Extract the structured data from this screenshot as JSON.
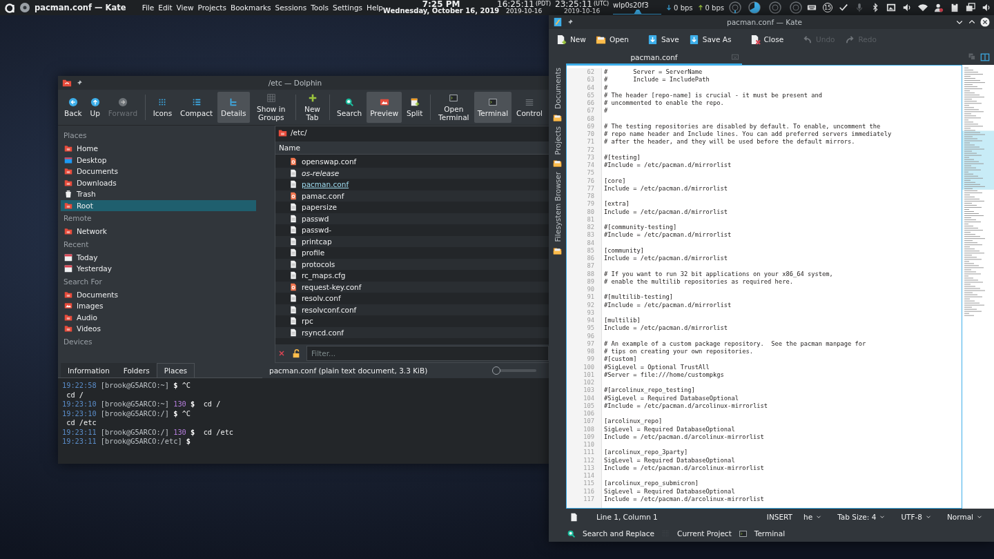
{
  "top_panel": {
    "app_title": "pacman.conf — Kate",
    "menu": [
      "File",
      "Edit",
      "View",
      "Projects",
      "Bookmarks",
      "Sessions",
      "Tools",
      "Settings",
      "Help"
    ],
    "clock": {
      "time": "7:25 PM",
      "date": "Wednesday, October 16, 2019"
    },
    "world_clocks": [
      {
        "time": "16:25:11",
        "zone": "(PDT)",
        "date": "2019-10-16"
      },
      {
        "time": "23:25:11",
        "zone": "(UTC)",
        "date": "2019-10-16"
      }
    ],
    "network": {
      "interface": "wlp0s20f3",
      "down": "0 bps",
      "up": "0 bps"
    },
    "notifications": "15"
  },
  "dolphin": {
    "title": "/etc — Dolphin",
    "toolbar": [
      [
        {
          "label": "Back",
          "selected": false,
          "disabled": false
        },
        {
          "label": "Up",
          "selected": false,
          "disabled": false
        },
        {
          "label": "Forward",
          "selected": false,
          "disabled": true
        }
      ],
      [
        {
          "label": "Icons",
          "selected": false,
          "disabled": false
        },
        {
          "label": "Compact",
          "selected": false,
          "disabled": false
        },
        {
          "label": "Details",
          "selected": true,
          "disabled": false
        },
        {
          "label": "Show in Groups",
          "selected": false,
          "disabled": false
        }
      ],
      [
        {
          "label": "New Tab",
          "selected": false,
          "disabled": false
        }
      ],
      [
        {
          "label": "Search",
          "selected": false,
          "disabled": false
        },
        {
          "label": "Preview",
          "selected": true,
          "disabled": false
        },
        {
          "label": "Split",
          "selected": false,
          "disabled": false
        }
      ],
      [
        {
          "label": "Open Terminal",
          "selected": false,
          "disabled": false
        },
        {
          "label": "Terminal",
          "selected": true,
          "disabled": false
        },
        {
          "label": "Control",
          "selected": false,
          "disabled": false
        }
      ]
    ],
    "sidebar": [
      {
        "heading": "Places",
        "items": [
          {
            "label": "Home",
            "selected": false
          },
          {
            "label": "Desktop",
            "selected": false
          },
          {
            "label": "Documents",
            "selected": false
          },
          {
            "label": "Downloads",
            "selected": false
          },
          {
            "label": "Trash",
            "selected": false
          },
          {
            "label": "Root",
            "selected": true
          }
        ]
      },
      {
        "heading": "Remote",
        "items": [
          {
            "label": "Network",
            "selected": false
          }
        ]
      },
      {
        "heading": "Recent",
        "items": [
          {
            "label": "Today",
            "selected": false
          },
          {
            "label": "Yesterday",
            "selected": false
          }
        ]
      },
      {
        "heading": "Search For",
        "items": [
          {
            "label": "Documents",
            "selected": false
          },
          {
            "label": "Images",
            "selected": false
          },
          {
            "label": "Audio",
            "selected": false
          },
          {
            "label": "Videos",
            "selected": false
          }
        ]
      },
      {
        "heading": "Devices"
      }
    ],
    "path": "/etc/",
    "column": "Name",
    "files": [
      {
        "name": "openswap.conf",
        "kind": "config",
        "symlink": false,
        "hovered": false
      },
      {
        "name": "os-release",
        "kind": "text",
        "symlink": true,
        "hovered": false
      },
      {
        "name": "pacman.conf",
        "kind": "text",
        "symlink": false,
        "hovered": true
      },
      {
        "name": "pamac.conf",
        "kind": "config",
        "symlink": false,
        "hovered": false
      },
      {
        "name": "papersize",
        "kind": "text",
        "symlink": false,
        "hovered": false
      },
      {
        "name": "passwd",
        "kind": "text",
        "symlink": false,
        "hovered": false
      },
      {
        "name": "passwd-",
        "kind": "text",
        "symlink": false,
        "hovered": false
      },
      {
        "name": "printcap",
        "kind": "text",
        "symlink": false,
        "hovered": false
      },
      {
        "name": "profile",
        "kind": "text",
        "symlink": false,
        "hovered": false
      },
      {
        "name": "protocols",
        "kind": "text",
        "symlink": false,
        "hovered": false
      },
      {
        "name": "rc_maps.cfg",
        "kind": "text",
        "symlink": false,
        "hovered": false
      },
      {
        "name": "request-key.conf",
        "kind": "config",
        "symlink": false,
        "hovered": false
      },
      {
        "name": "resolv.conf",
        "kind": "text",
        "symlink": false,
        "hovered": false
      },
      {
        "name": "resolvconf.conf",
        "kind": "text",
        "symlink": false,
        "hovered": false
      },
      {
        "name": "rpc",
        "kind": "text",
        "symlink": false,
        "hovered": false
      },
      {
        "name": "rsyncd.conf",
        "kind": "text",
        "symlink": false,
        "hovered": false
      }
    ],
    "filter": {
      "placeholder": "Filter..."
    },
    "panel_tabs": [
      {
        "label": "Information",
        "selected": false
      },
      {
        "label": "Folders",
        "selected": false
      },
      {
        "label": "Places",
        "selected": true
      }
    ],
    "status": "pacman.conf (plain text document, 3.3 KiB)",
    "zoom": {
      "level": 0
    },
    "terminal": [
      {
        "kind": "prompt",
        "time": "19:22:58",
        "prompt": "[brook@G5ARCO:~]",
        "symbol": "$",
        "command": "^C"
      },
      {
        "kind": "output",
        "text": "cd /"
      },
      {
        "kind": "prompt",
        "time": "19:23:10",
        "prompt": "[brook@G5ARCO:~]",
        "code": "130",
        "symbol": "$",
        "command": " cd /"
      },
      {
        "kind": "prompt",
        "time": "19:23:10",
        "prompt": "[brook@G5ARCO:/]",
        "symbol": "$",
        "command": "^C"
      },
      {
        "kind": "output",
        "text": "cd /etc"
      },
      {
        "kind": "prompt",
        "time": "19:23:11",
        "prompt": "[brook@G5ARCO:/]",
        "code": "130",
        "symbol": "$",
        "command": " cd /etc"
      },
      {
        "kind": "prompt",
        "time": "19:23:11",
        "prompt": "[brook@G5ARCO:/etc]",
        "symbol": "$"
      }
    ]
  },
  "kate": {
    "title": "pacman.conf — Kate",
    "toolbar": [
      [
        {
          "label": "New",
          "disabled": false
        },
        {
          "label": "Open",
          "disabled": false
        }
      ],
      [
        {
          "label": "Save",
          "disabled": false
        },
        {
          "label": "Save As",
          "disabled": false
        }
      ],
      [
        {
          "label": "Close",
          "disabled": false
        }
      ],
      [
        {
          "label": "Undo",
          "disabled": true
        },
        {
          "label": "Redo",
          "disabled": true
        }
      ]
    ],
    "tab": "pacman.conf",
    "side_tabs": [
      "Documents",
      "Projects",
      "Filesystem Browser"
    ],
    "lines": [
      {
        "n": "62",
        "text": "#       Server = ServerName"
      },
      {
        "n": "63",
        "text": "#       Include = IncludePath"
      },
      {
        "n": "64",
        "text": "#"
      },
      {
        "n": "65",
        "text": "# The header [repo-name] is crucial - it must be present and"
      },
      {
        "n": "66",
        "text": "# uncommented to enable the repo."
      },
      {
        "n": "67",
        "text": "#"
      },
      {
        "n": "68"
      },
      {
        "n": "69",
        "text": "# The testing repositories are disabled by default. To enable, uncomment the"
      },
      {
        "n": "70",
        "text": "# repo name header and Include lines. You can add preferred servers immediately"
      },
      {
        "n": "71",
        "text": "# after the header, and they will be used before the default mirrors."
      },
      {
        "n": "72"
      },
      {
        "n": "73",
        "text": "#[testing]"
      },
      {
        "n": "74",
        "text": "#Include = /etc/pacman.d/mirrorlist"
      },
      {
        "n": "75"
      },
      {
        "n": "76",
        "text": "[core]"
      },
      {
        "n": "77",
        "text": "Include = /etc/pacman.d/mirrorlist"
      },
      {
        "n": "78"
      },
      {
        "n": "79",
        "text": "[extra]"
      },
      {
        "n": "80",
        "text": "Include = /etc/pacman.d/mirrorlist"
      },
      {
        "n": "81"
      },
      {
        "n": "82",
        "text": "#[community-testing]"
      },
      {
        "n": "83",
        "text": "#Include = /etc/pacman.d/mirrorlist"
      },
      {
        "n": "84"
      },
      {
        "n": "85",
        "text": "[community]"
      },
      {
        "n": "86",
        "text": "Include = /etc/pacman.d/mirrorlist"
      },
      {
        "n": "87"
      },
      {
        "n": "88",
        "text": "# If you want to run 32 bit applications on your x86_64 system,"
      },
      {
        "n": "89",
        "text": "# enable the multilib repositories as required here."
      },
      {
        "n": "90"
      },
      {
        "n": "91",
        "text": "#[multilib-testing]"
      },
      {
        "n": "92",
        "text": "#Include = /etc/pacman.d/mirrorlist"
      },
      {
        "n": "93"
      },
      {
        "n": "94",
        "text": "[multilib]"
      },
      {
        "n": "95",
        "text": "Include = /etc/pacman.d/mirrorlist"
      },
      {
        "n": "96"
      },
      {
        "n": "97",
        "text": "# An example of a custom package repository.  See the pacman manpage for"
      },
      {
        "n": "98",
        "text": "# tips on creating your own repositories."
      },
      {
        "n": "99",
        "text": "#[custom]"
      },
      {
        "n": "100",
        "text": "#SigLevel = Optional TrustAll"
      },
      {
        "n": "101",
        "text": "#Server = file:///home/custompkgs"
      },
      {
        "n": "102"
      },
      {
        "n": "103",
        "text": "#[arcolinux_repo_testing]"
      },
      {
        "n": "104",
        "text": "#SigLevel = Required DatabaseOptional"
      },
      {
        "n": "105",
        "text": "#Include = /etc/pacman.d/arcolinux-mirrorlist"
      },
      {
        "n": "106"
      },
      {
        "n": "107",
        "text": "[arcolinux_repo]"
      },
      {
        "n": "108",
        "text": "SigLevel = Required DatabaseOptional"
      },
      {
        "n": "109",
        "text": "Include = /etc/pacman.d/arcolinux-mirrorlist"
      },
      {
        "n": "110"
      },
      {
        "n": "111",
        "text": "[arcolinux_repo_3party]"
      },
      {
        "n": "112",
        "text": "SigLevel = Required DatabaseOptional"
      },
      {
        "n": "113",
        "text": "Include = /etc/pacman.d/arcolinux-mirrorlist"
      },
      {
        "n": "114"
      },
      {
        "n": "115",
        "text": "[arcolinux_repo_submicron]"
      },
      {
        "n": "116",
        "text": "SigLevel = Required DatabaseOptional"
      },
      {
        "n": "117",
        "text": "Include = /etc/pacman.d/arcolinux-mirrorlist"
      }
    ],
    "status": {
      "position": "Line 1, Column 1",
      "mode": "INSERT",
      "dictionary": "he",
      "tab_size": "Tab Size: 4",
      "encoding": "UTF-8",
      "highlight": "Normal"
    },
    "tool_tabs": [
      "Search and Replace",
      "Current Project",
      "Terminal"
    ]
  }
}
